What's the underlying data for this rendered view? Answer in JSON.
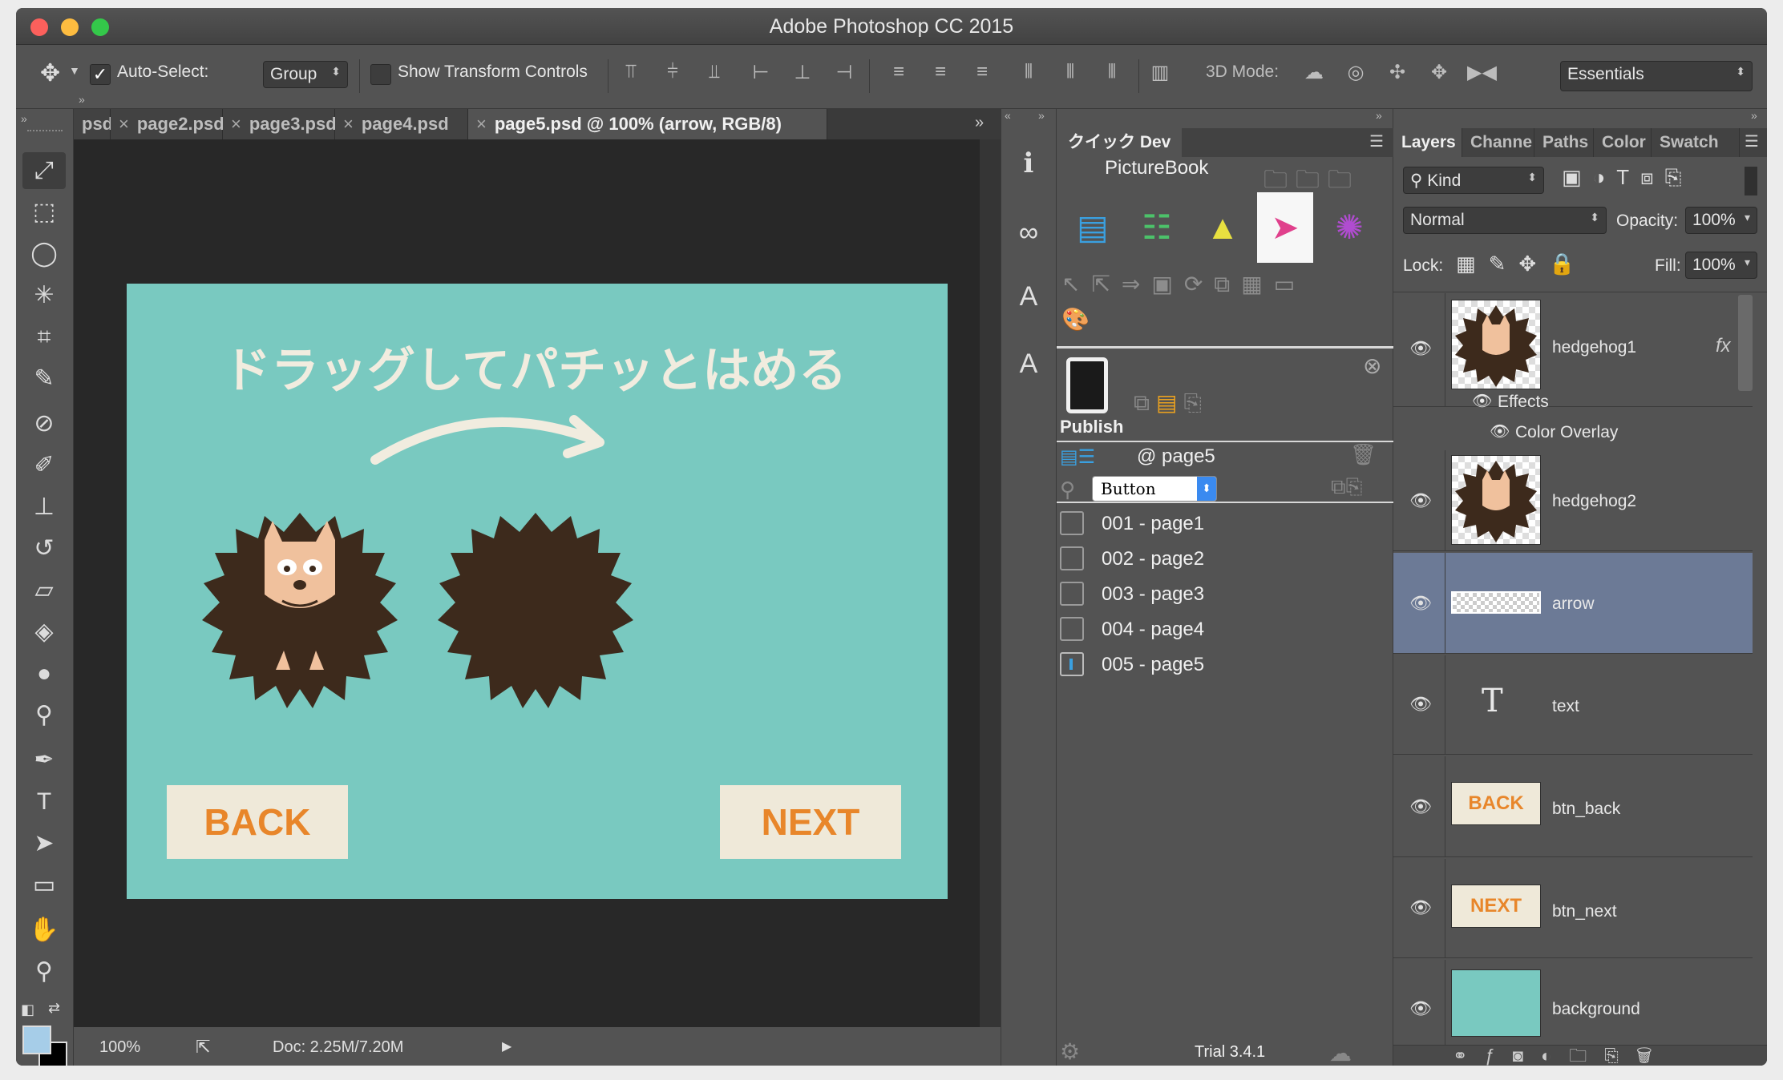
{
  "app": {
    "title": "Adobe Photoshop CC 2015"
  },
  "options": {
    "auto_select_label": "Auto-Select:",
    "auto_select_value": "Group",
    "show_transform_label": "Show Transform Controls",
    "mode_3d_label": "3D Mode:",
    "workspace": "Essentials"
  },
  "tabs": [
    {
      "label": "psd",
      "active": false
    },
    {
      "label": "page2.psd",
      "active": false
    },
    {
      "label": "page3.psd",
      "active": false
    },
    {
      "label": "page4.psd",
      "active": false
    },
    {
      "label": "page5.psd @ 100% (arrow, RGB/8)",
      "active": true
    }
  ],
  "canvas": {
    "headline": "ドラッグしてパチッとはめる",
    "back_label": "BACK",
    "next_label": "NEXT",
    "bg_color": "#79c9c0",
    "accent_color": "#e8862a"
  },
  "status": {
    "zoom": "100%",
    "doc": "Doc: 2.25M/7.20M"
  },
  "quickdev": {
    "tab_label": "クイック Dev",
    "title": "PictureBook",
    "publish_label": "Publish",
    "page_ref": "@ page5",
    "type_select": "Button",
    "pages": [
      "001 - page1",
      "002 - page2",
      "003 - page3",
      "004 - page4",
      "005 - page5"
    ],
    "version": "Trial 3.4.1"
  },
  "layers_panel": {
    "tabs": [
      "Layers",
      "Channe",
      "Paths",
      "Color",
      "Swatch"
    ],
    "filter_kind": "Kind",
    "blend_mode": "Normal",
    "opacity_label": "Opacity:",
    "opacity_value": "100%",
    "lock_label": "Lock:",
    "fill_label": "Fill:",
    "fill_value": "100%",
    "effects_label": "Effects",
    "color_overlay_label": "Color Overlay",
    "layers": [
      {
        "name": "hedgehog1",
        "fx": "fx"
      },
      {
        "name": "hedgehog2"
      },
      {
        "name": "arrow",
        "selected": true
      },
      {
        "name": "text"
      },
      {
        "name": "btn_back",
        "thumb_text": "BACK"
      },
      {
        "name": "btn_next",
        "thumb_text": "NEXT"
      },
      {
        "name": "background"
      }
    ]
  }
}
